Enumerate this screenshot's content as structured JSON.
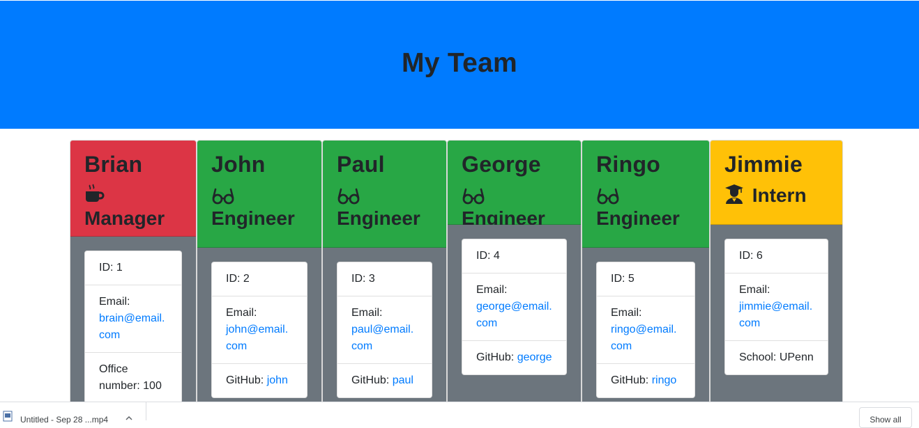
{
  "header": {
    "title": "My Team"
  },
  "colors": {
    "jumbotron": "#007bff",
    "manager": "#dc3545",
    "engineer": "#28a745",
    "intern": "#ffc107",
    "card_body": "#6c757d",
    "link": "#007bff"
  },
  "team": [
    {
      "name": "Brian",
      "role": "Manager",
      "icon": "coffee-icon",
      "id_text": "ID: 1",
      "email_label": "Email:",
      "email": "brain@email.com",
      "extra_label": "Office number: 100",
      "extra_link": ""
    },
    {
      "name": "John",
      "role": "Engineer",
      "icon": "glasses-icon",
      "id_text": "ID: 2",
      "email_label": "Email:",
      "email": "john@email.com",
      "extra_label": "GitHub: ",
      "extra_link": "john"
    },
    {
      "name": "Paul",
      "role": "Engineer",
      "icon": "glasses-icon",
      "id_text": "ID: 3",
      "email_label": "Email:",
      "email": "paul@email.com",
      "extra_label": "GitHub: ",
      "extra_link": "paul"
    },
    {
      "name": "George",
      "role": "Engineer",
      "icon": "glasses-icon",
      "id_text": "ID: 4",
      "email_label": "Email:",
      "email": "george@email.com",
      "extra_label": "GitHub: ",
      "extra_link": "george"
    },
    {
      "name": "Ringo",
      "role": "Engineer",
      "icon": "glasses-icon",
      "id_text": "ID: 5",
      "email_label": "Email:",
      "email": "ringo@email.com",
      "extra_label": "GitHub: ",
      "extra_link": "ringo"
    },
    {
      "name": "Jimmie",
      "role": "Intern",
      "icon": "graduate-icon",
      "id_text": "ID: 6",
      "email_label": "Email:",
      "email": "jimmie@email.com",
      "extra_label": "School: UPenn",
      "extra_link": ""
    }
  ],
  "download_bar": {
    "file_label": "Untitled - Sep 28 ...mp4",
    "show_all": "Show all"
  }
}
